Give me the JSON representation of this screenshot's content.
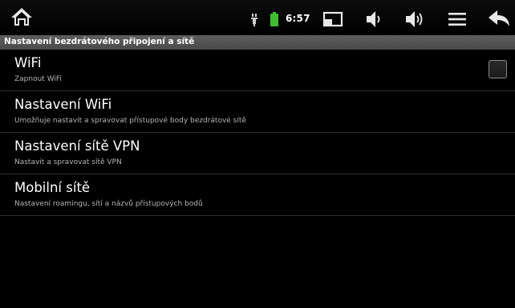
{
  "status_bar": {
    "time": "6:57",
    "icons": [
      "home-icon",
      "usb-icon",
      "battery-icon",
      "screen-icon",
      "volume-down-icon",
      "volume-up-icon",
      "menu-icon",
      "back-icon"
    ],
    "battery_color": "#3fbf2f"
  },
  "header": {
    "title": "Nastavení bezdrátového připojení a sítě"
  },
  "settings": {
    "wifi": {
      "title": "WiFi",
      "summary": "Zapnout WiFi",
      "checked": false
    },
    "wifi_settings": {
      "title": "Nastavení WiFi",
      "summary": "Umožňuje nastavit a spravovat přístupové body bezdrátové sítě"
    },
    "vpn": {
      "title": "Nastavení sítě VPN",
      "summary": "Nastavit a spravovat sítě VPN"
    },
    "mobile": {
      "title": "Mobilní sítě",
      "summary": "Nastavení roamingu, sítí a názvů přístupových bodů"
    }
  }
}
